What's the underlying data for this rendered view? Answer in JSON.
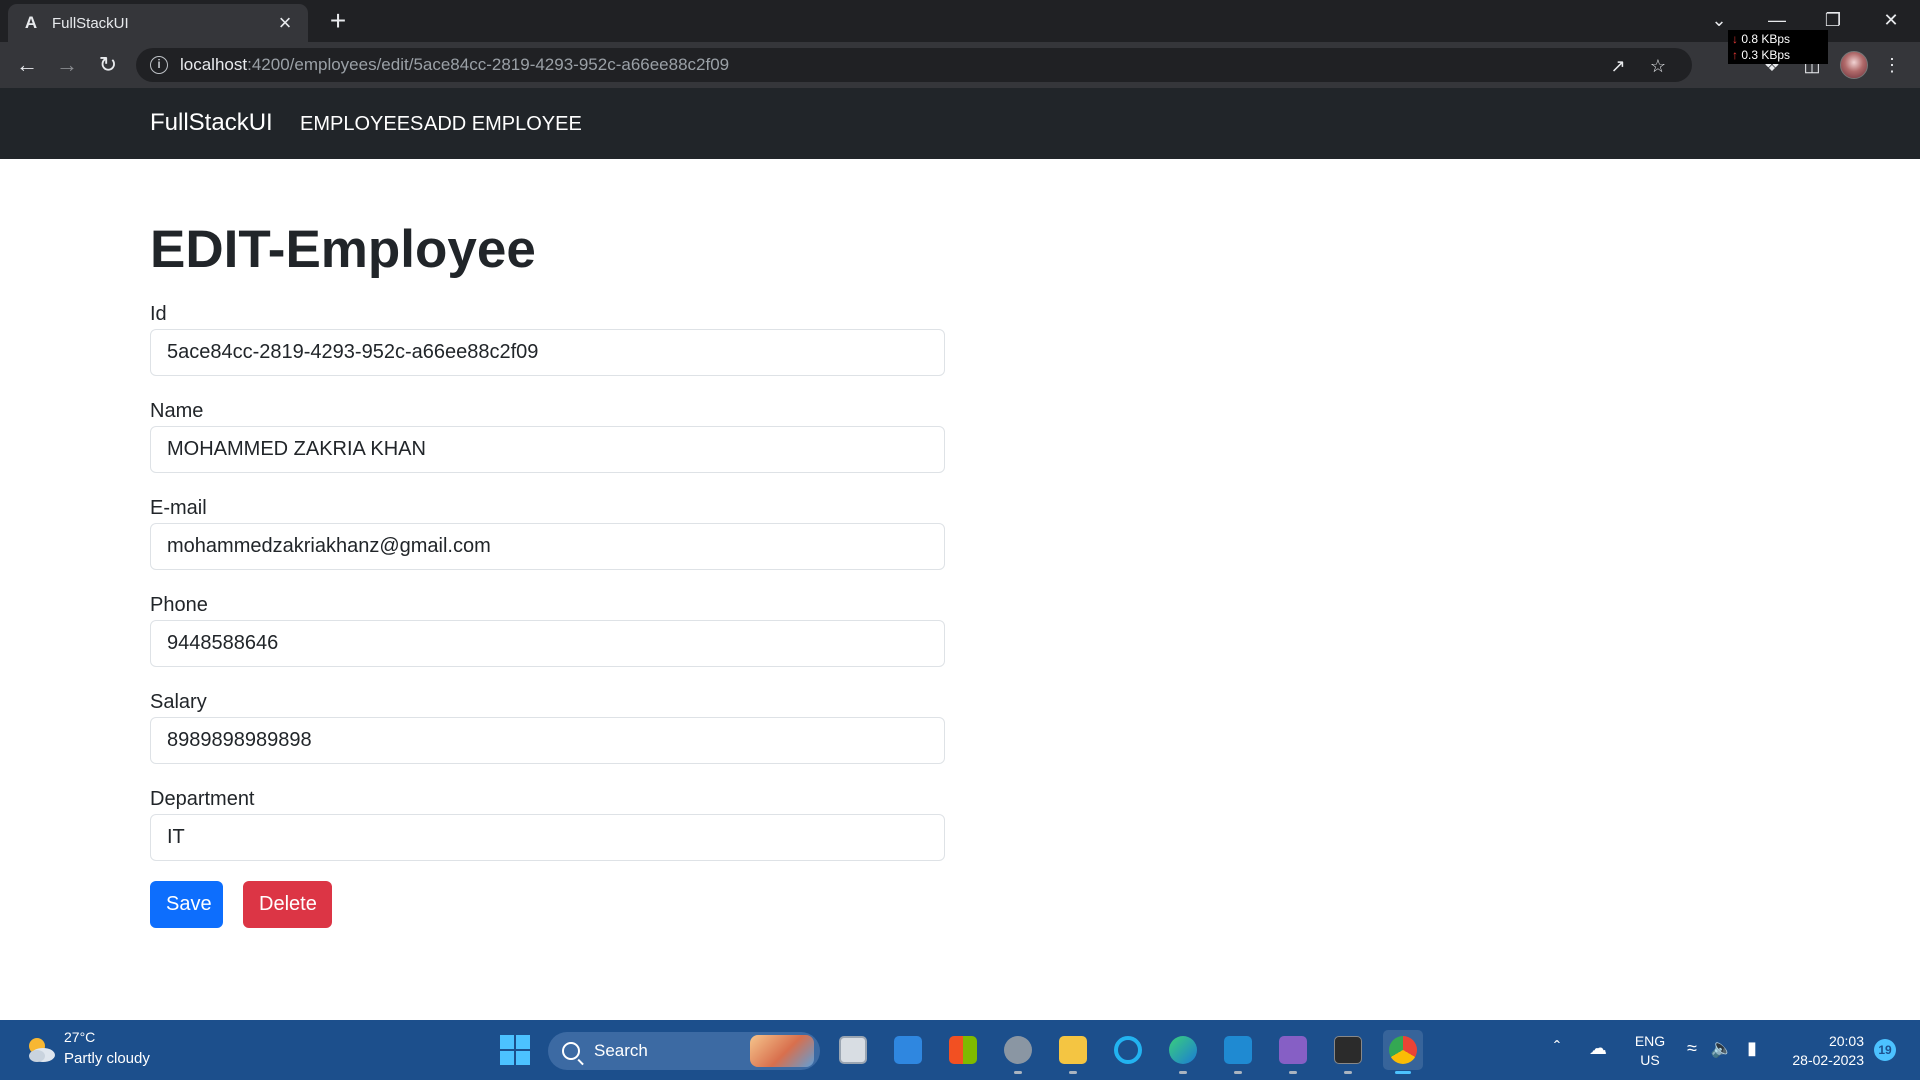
{
  "browser": {
    "tab_title": "FullStackUI",
    "tab_favicon": "A",
    "tab_close": "×",
    "new_tab": "+",
    "url_host": "localhost",
    "url_path": ":4200/employees/edit/5ace84cc-2819-4293-952c-a66ee88c2f09",
    "net_down": "0.8 KBps",
    "net_up": "0.3 KBps"
  },
  "navbar": {
    "brand": "FullStackUI",
    "links": [
      "EMPLOYEES",
      "ADD EMPLOYEE"
    ]
  },
  "form": {
    "title": "EDIT-Employee",
    "fields": [
      {
        "label": "Id",
        "value": "5ace84cc-2819-4293-952c-a66ee88c2f09"
      },
      {
        "label": "Name",
        "value": "MOHAMMED ZAKRIA KHAN"
      },
      {
        "label": "E-mail",
        "value": "mohammedzakriakhanz@gmail.com"
      },
      {
        "label": "Phone",
        "value": "9448588646"
      },
      {
        "label": "Salary",
        "value": "8989898989898"
      },
      {
        "label": "Department",
        "value": "IT"
      }
    ],
    "save_label": "Save",
    "delete_label": "Delete"
  },
  "taskbar": {
    "weather_temp": "27°C",
    "weather_desc": "Partly cloudy",
    "search_label": "Search",
    "lang_line1": "ENG",
    "lang_line2": "US",
    "time": "20:03",
    "date": "28-02-2023",
    "notification_count": "19"
  },
  "colors": {
    "primary": "#0d6efd",
    "danger": "#dc3545",
    "navbar_bg": "#212529",
    "taskbar_bg": "#1c4f8c"
  }
}
